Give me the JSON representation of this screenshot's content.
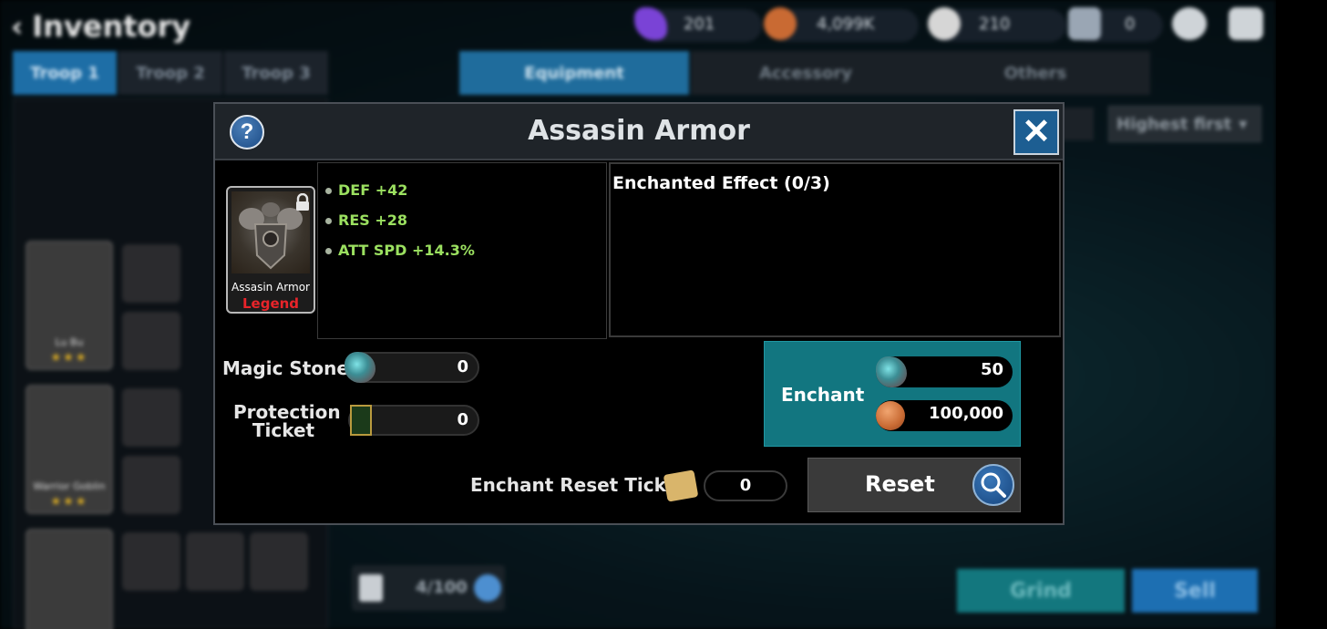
{
  "header": {
    "title": "Inventory"
  },
  "currencies": [
    {
      "name": "crystal",
      "value": "201",
      "color": "#7a43d6"
    },
    {
      "name": "gold",
      "value": "4,099K",
      "color": "#c96a33"
    },
    {
      "name": "stamina",
      "value": "210",
      "color": "#d6d6d6"
    },
    {
      "name": "ticket",
      "value": "0",
      "color": "#9aa6b4"
    }
  ],
  "troop_tabs": [
    "Troop 1",
    "Troop 2",
    "Troop 3"
  ],
  "equipment_tabs": [
    "Equipment",
    "Accessory",
    "Others"
  ],
  "heroes": [
    {
      "name": "Lu Bu",
      "stars": "★★★"
    },
    {
      "name": "Warrior Goblin",
      "stars": "★★★"
    },
    {
      "name": "",
      "stars": ""
    }
  ],
  "sort": {
    "label": "Highest first"
  },
  "inventory_count": "4/100",
  "bottom_buttons": {
    "grind": "Grind",
    "sell": "Sell"
  },
  "modal": {
    "title": "Assasin Armor",
    "help": "?",
    "close": "✕",
    "item": {
      "name": "Assasin Armor",
      "grade": "Legend",
      "grade_color": "#e8242a"
    },
    "stats": [
      "DEF +42",
      "RES +28",
      "ATT SPD +14.3%"
    ],
    "enchanted_effect_title": "Enchanted Effect (0/3)",
    "materials": {
      "magic_stone_label": "Magic Stone",
      "magic_stone_value": "0",
      "protection_ticket_label_line1": "Protection",
      "protection_ticket_label_line2": "Ticket",
      "protection_ticket_value": "0"
    },
    "enchant": {
      "label": "Enchant",
      "stone_cost": "50",
      "gold_cost": "100,000"
    },
    "reset_ticket": {
      "label": "Enchant Reset Ticket",
      "value": "0"
    },
    "reset": {
      "label": "Reset"
    }
  }
}
